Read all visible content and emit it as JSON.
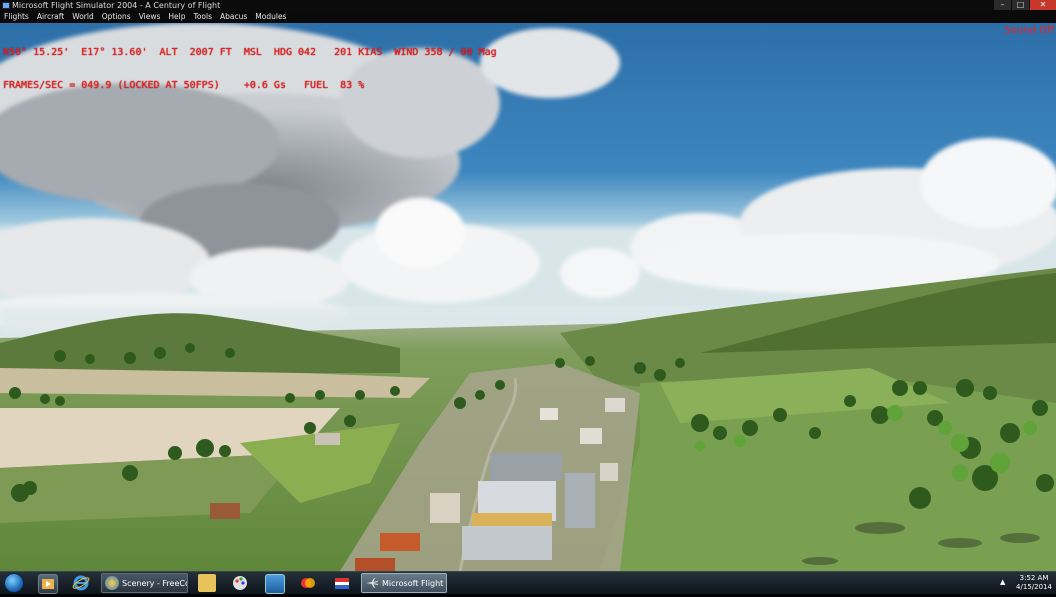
{
  "window": {
    "title": "Microsoft Flight Simulator 2004 - A Century of Flight",
    "buttons": {
      "minimize": "–",
      "maximize": "□",
      "close": "✕"
    }
  },
  "menu": [
    "Flights",
    "Aircraft",
    "World",
    "Options",
    "Views",
    "Help",
    "Tools",
    "Abacus",
    "Modules"
  ],
  "hud": {
    "line1": "N50° 15.25'  E17° 13.60'  ALT  2007 FT  MSL  HDG 042   201 KIAS  WIND 358 / 00 Mag",
    "line2": "FRAMES/SEC = 049.9 (LOCKED AT 50FPS)    +0.6 Gs   FUEL  83 %",
    "sound": "Sound Off",
    "color": "#ff1a1a"
  },
  "taskbar": {
    "tasks": [
      {
        "label": "Scenery - FreeCo...",
        "icon": "globe-icon"
      },
      {
        "label": "Microsoft Flight S...",
        "icon": "airplane-icon"
      }
    ],
    "pinned_icons": [
      "windows-start-icon",
      "media-player-icon",
      "internet-explorer-icon",
      "folder-icon",
      "paint-icon",
      "monitor-icon",
      "game-icon",
      "flag-icon"
    ],
    "clock": {
      "time": "3:52 AM",
      "date": "4/15/2014"
    }
  }
}
